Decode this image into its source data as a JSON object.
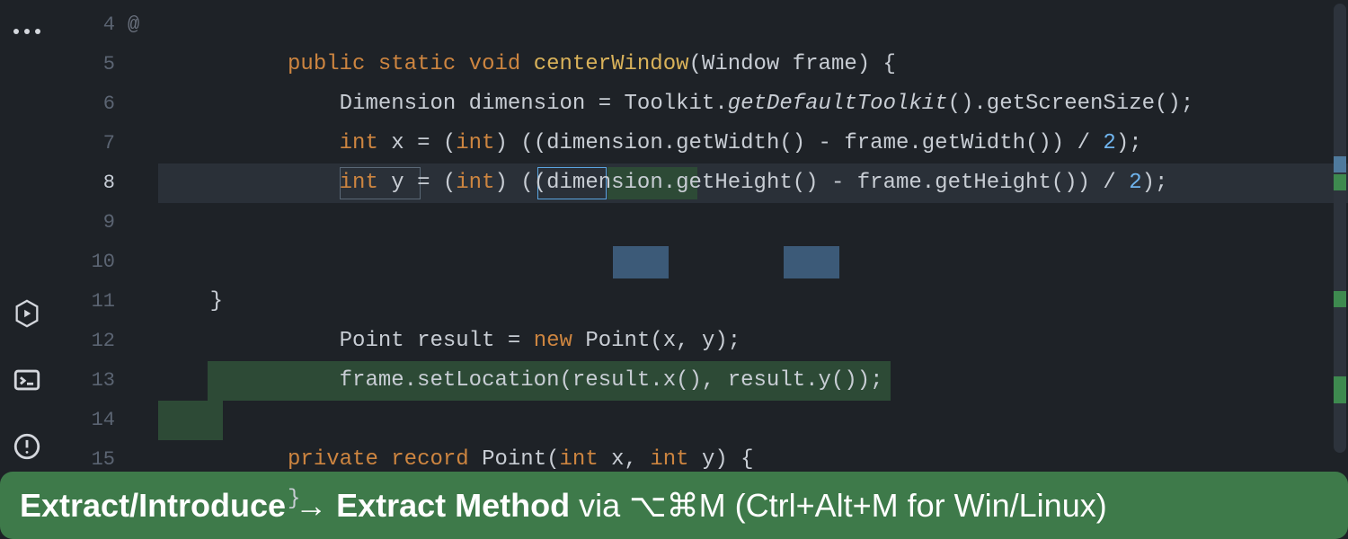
{
  "gutter": {
    "lines": [
      "4",
      "5",
      "6",
      "7",
      "8",
      "9",
      "10",
      "11",
      "12",
      "13",
      "14",
      "15"
    ],
    "current_index": 4,
    "annotation_first": "@"
  },
  "code": {
    "l4": {
      "kw": "public static void",
      "fn": "centerWindow",
      "sig": "(Window frame) {"
    },
    "l5": {
      "type": "Dimension",
      "var": "dimension",
      "eq": " = ",
      "call1": "Toolkit.",
      "ital": "getDefaultToolkit",
      "rest": "().getScreenSize();"
    },
    "l6": {
      "kw1": "int",
      "var": " x = (",
      "kw2": "int",
      "rest": ") ((dimension.getWidth() - frame.getWidth()) / ",
      "num": "2",
      "end": ");"
    },
    "l7": {
      "kw1": "int",
      "var": " y = (",
      "kw2": "int",
      "rest": ") ((dimension.getHeight() - frame.getHeight()) / ",
      "num": "2",
      "end": ");"
    },
    "l8": {
      "type": "Point",
      "sp": " ",
      "var": "result",
      "eq": " = ",
      "kw": "new",
      "sp2": " ",
      "type2": "Point",
      "args": "(x, y);"
    },
    "l9": "",
    "l10": {
      "call": "frame.setLocation(result",
      "m1": ".x()",
      "c": ", result",
      "m2": ".y()",
      "end": ");"
    },
    "l11": "}",
    "l12": "",
    "l13": {
      "kw": "private",
      "sp": " ",
      "kw2": "record",
      "sp2": " ",
      "type": "Point",
      "sig": "(",
      "t1": "int",
      "a1": " x, ",
      "t2": "int",
      "a2": " y) {"
    },
    "l14": "}",
    "l15": ""
  },
  "hint": {
    "bold1": "Extract/Introduce → Extract Method",
    "via": " via ",
    "shortcut_mac": "⌥⌘M",
    "paren": " (Ctrl+Alt+M for Win/Linux)"
  }
}
